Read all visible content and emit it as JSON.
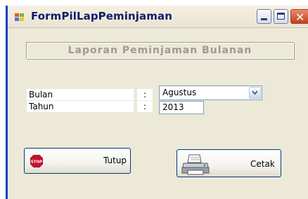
{
  "window": {
    "title": "FormPilLapPeminjaman"
  },
  "header": {
    "label": "Laporan Peminjaman Bulanan"
  },
  "form": {
    "bulan_label": "Bulan",
    "tahun_label": "Tahun",
    "separator": ":",
    "bulan_value": "Agustus",
    "tahun_value": "2013"
  },
  "buttons": {
    "tutup_label": "Tutup",
    "cetak_label": "Cetak",
    "stop_icon_text": "STOP"
  },
  "icons": {
    "app": "app-window-icon",
    "minimize": "minimize-icon",
    "maximize": "maximize-icon",
    "close": "close-icon",
    "dropdown": "chevron-down-icon",
    "stop": "stop-sign-icon",
    "printer": "printer-icon"
  },
  "colors": {
    "window_bg": "#ece9d8",
    "title_text": "#0d1d66",
    "header_text": "#a09a8c",
    "input_border": "#7f9db9",
    "button_border": "#003c74",
    "close_button": "#c1411f",
    "stop_red": "#c8102e"
  }
}
